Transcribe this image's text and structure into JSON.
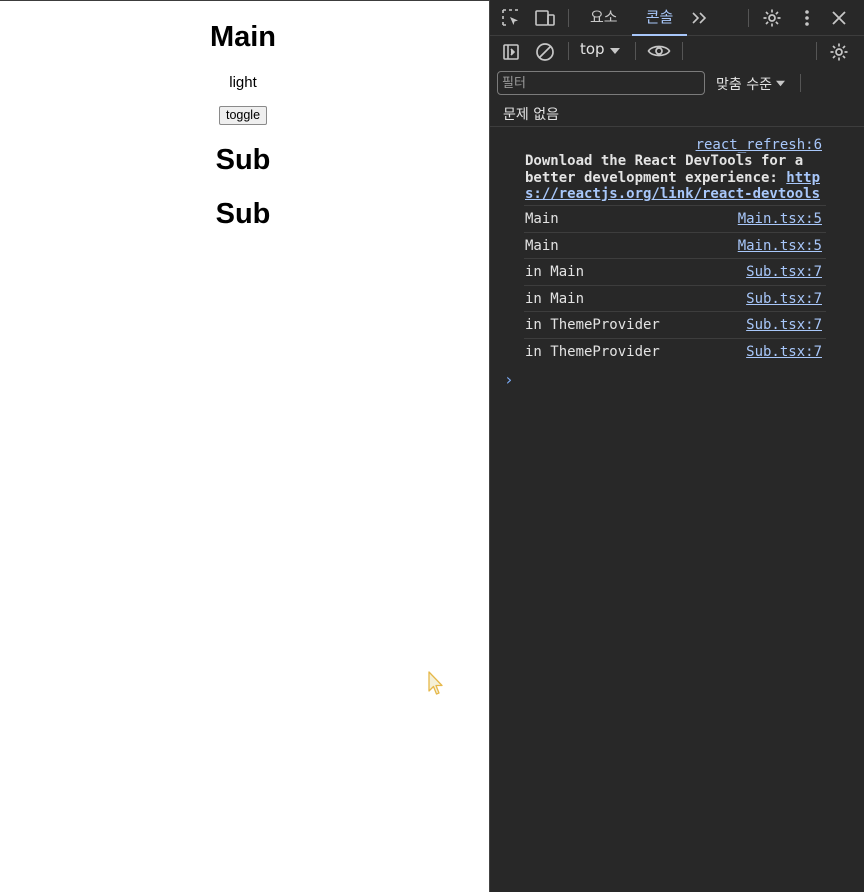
{
  "page": {
    "heading": "Main",
    "theme_value": "light",
    "toggle_label": "toggle",
    "sub_headings": [
      "Sub",
      "Sub"
    ]
  },
  "devtools": {
    "tabs": [
      {
        "label": "요소",
        "active": false
      },
      {
        "label": "콘솔",
        "active": true
      }
    ],
    "context_label": "top",
    "filter_placeholder": "필터",
    "levels_label": "맞춤 수준",
    "issues_label": "문제 없음",
    "console": {
      "first_message": {
        "source": "react_refresh:6",
        "text_prefix": "Download the React DevTools for a better development experience: ",
        "link": "https://reactjs.org/link/react-devtools"
      },
      "messages": [
        {
          "text": "Main",
          "source": "Main.tsx:5"
        },
        {
          "text": "Main",
          "source": "Main.tsx:5"
        },
        {
          "text": "in Main",
          "source": "Sub.tsx:7"
        },
        {
          "text": "in Main",
          "source": "Sub.tsx:7"
        },
        {
          "text": "in ThemeProvider",
          "source": "Sub.tsx:7"
        },
        {
          "text": "in ThemeProvider",
          "source": "Sub.tsx:7"
        }
      ],
      "prompt_symbol": "›"
    },
    "colors": {
      "background": "#282828",
      "accent": "#a8c7fa",
      "text": "#e3e3e3"
    }
  }
}
